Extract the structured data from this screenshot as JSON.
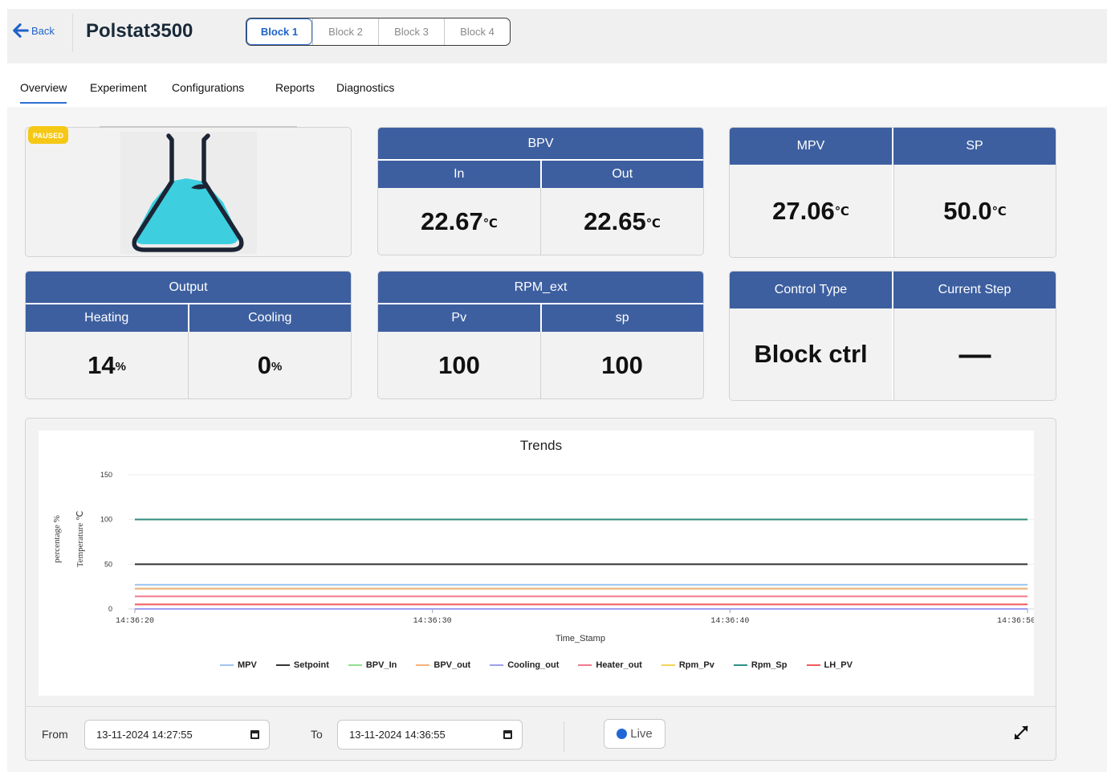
{
  "header": {
    "back_label": "Back",
    "title": "Polstat3500",
    "blocks": [
      "Block 1",
      "Block 2",
      "Block 3",
      "Block 4"
    ],
    "active_block": "Block 1"
  },
  "tabs": [
    "Overview",
    "Experiment",
    "Configurations",
    "Reports",
    "Diagnostics"
  ],
  "active_tab": "Overview",
  "status_badge": "PAUSED",
  "bpv": {
    "title": "BPV",
    "in_label": "In",
    "out_label": "Out",
    "in_value": "22.67",
    "out_value": "22.65",
    "unit": "℃"
  },
  "mpv_sp": {
    "mpv_label": "MPV",
    "sp_label": "SP",
    "mpv_value": "27.06",
    "sp_value": "50.0",
    "unit": "℃"
  },
  "output": {
    "title": "Output",
    "heating_label": "Heating",
    "cooling_label": "Cooling",
    "heating_value": "14",
    "cooling_value": "0",
    "unit": "%"
  },
  "rpm": {
    "title": "RPM_ext",
    "pv_label": "Pv",
    "sp_label": "sp",
    "pv_value": "100",
    "sp_value": "100"
  },
  "control": {
    "type_label": "Control Type",
    "step_label": "Current Step",
    "type_value": "Block ctrl",
    "step_value": "—"
  },
  "colors": {
    "header_blue": "#3d5fa0",
    "accent": "#2f6ed3",
    "paused": "#f5c816",
    "flask_liquid": "#3dcfe0",
    "flask_outline": "#1c2535"
  },
  "chart_data": {
    "type": "line",
    "title": "Trends",
    "xlabel": "Time_Stamp",
    "ylabel": "Temperature ℃",
    "ylabel2": "percentage %",
    "x": [
      "14:36:20",
      "14:36:30",
      "14:36:40",
      "14:36:50"
    ],
    "yticks": [
      0,
      50,
      100,
      150
    ],
    "ylim": [
      0,
      150
    ],
    "legend_position": "bottom",
    "series": [
      {
        "name": "MPV",
        "color": "#9ec5f0",
        "values": [
          27.06,
          27.06,
          27.06,
          27.06
        ]
      },
      {
        "name": "Setpoint",
        "color": "#333333",
        "values": [
          50,
          50,
          50,
          50
        ]
      },
      {
        "name": "BPV_In",
        "color": "#8ee08e",
        "values": [
          22.67,
          22.67,
          22.67,
          22.67
        ]
      },
      {
        "name": "BPV_out",
        "color": "#f5b27a",
        "values": [
          22.65,
          22.65,
          22.65,
          22.65
        ]
      },
      {
        "name": "Cooling_out",
        "color": "#9f9ff0",
        "values": [
          0,
          0,
          0,
          0
        ]
      },
      {
        "name": "Heater_out",
        "color": "#f07a8c",
        "values": [
          14,
          14,
          14,
          14
        ]
      },
      {
        "name": "Rpm_Pv",
        "color": "#f2d35a",
        "values": [
          100,
          100,
          100,
          100
        ]
      },
      {
        "name": "Rpm_Sp",
        "color": "#2f8f86",
        "values": [
          100,
          100,
          100,
          100
        ]
      },
      {
        "name": "LH_PV",
        "color": "#f25a5a",
        "values": [
          5,
          5,
          5,
          5
        ]
      }
    ]
  },
  "footer": {
    "from_label": "From",
    "to_label": "To",
    "from_value": "13-11-2024 14:27:55",
    "to_value": "13-11-2024 14:36:55",
    "live_label": "Live"
  }
}
